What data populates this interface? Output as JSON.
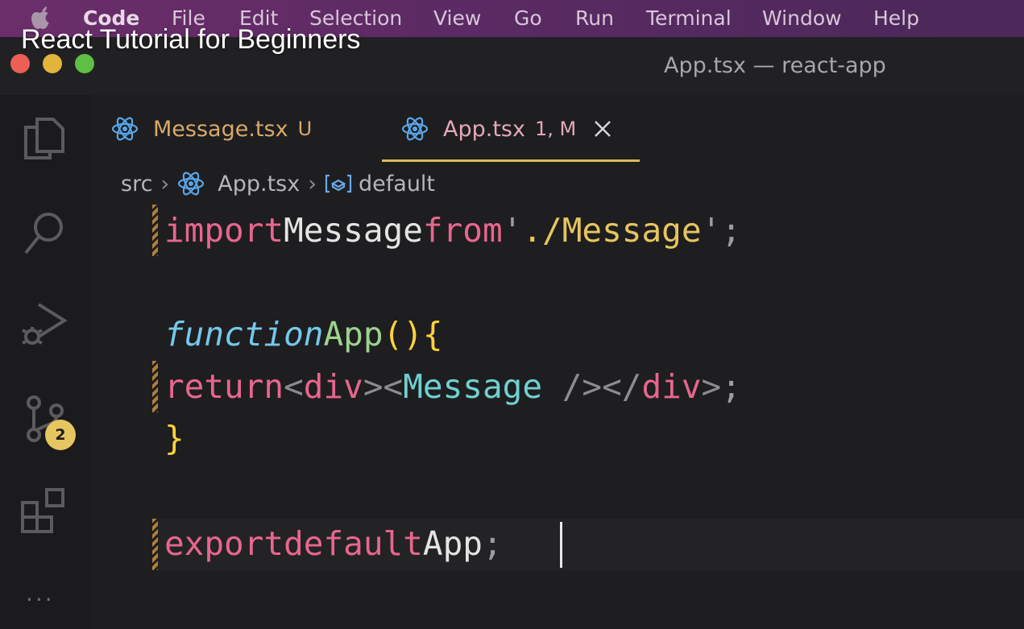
{
  "menubar": {
    "app": "Code",
    "items": [
      "File",
      "Edit",
      "Selection",
      "View",
      "Go",
      "Run",
      "Terminal",
      "Window",
      "Help"
    ]
  },
  "video_title": "React Tutorial for Beginners",
  "window": {
    "title": "App.tsx — react-app"
  },
  "activity_bar": {
    "icons": [
      "explorer-icon",
      "search-icon",
      "run-debug-icon",
      "source-control-icon",
      "extensions-icon",
      "more-icon"
    ],
    "source_control_badge": "2",
    "more": "···"
  },
  "tabs": [
    {
      "label": "Message.tsx",
      "status": "U",
      "active": false
    },
    {
      "label": "App.tsx",
      "status": "1, M",
      "active": true
    }
  ],
  "breadcrumb": {
    "folder": "src",
    "file": "App.tsx",
    "symbol": "default"
  },
  "code": {
    "line1": {
      "kw_import": "import",
      "ident": "Message",
      "kw_from": "from",
      "quote_open": "'",
      "path": "./Message",
      "quote_close": "'",
      "semi": ";"
    },
    "line3": {
      "kw_function": "function",
      "name": "App",
      "parens": "()",
      "brace": "{"
    },
    "line4": {
      "kw_return": "return",
      "lt1": "<",
      "div1": "div",
      "gt1": ">",
      "lt2": "<",
      "comp": "Message",
      "selfclose": " />",
      "lt3": "</",
      "div2": "div",
      "gt3": ">",
      "semi": ";"
    },
    "line5": {
      "brace": "}"
    },
    "line7": {
      "kw_export": "export",
      "kw_default": "default",
      "ident": "App",
      "semi": ";"
    }
  },
  "colors": {
    "keyword": "#e8668d",
    "string": "#e6c55f",
    "function": "#75c8ea",
    "component": "#6fd0d1",
    "accent_tab": "#d9bb5c",
    "badge": "#e6c660"
  }
}
